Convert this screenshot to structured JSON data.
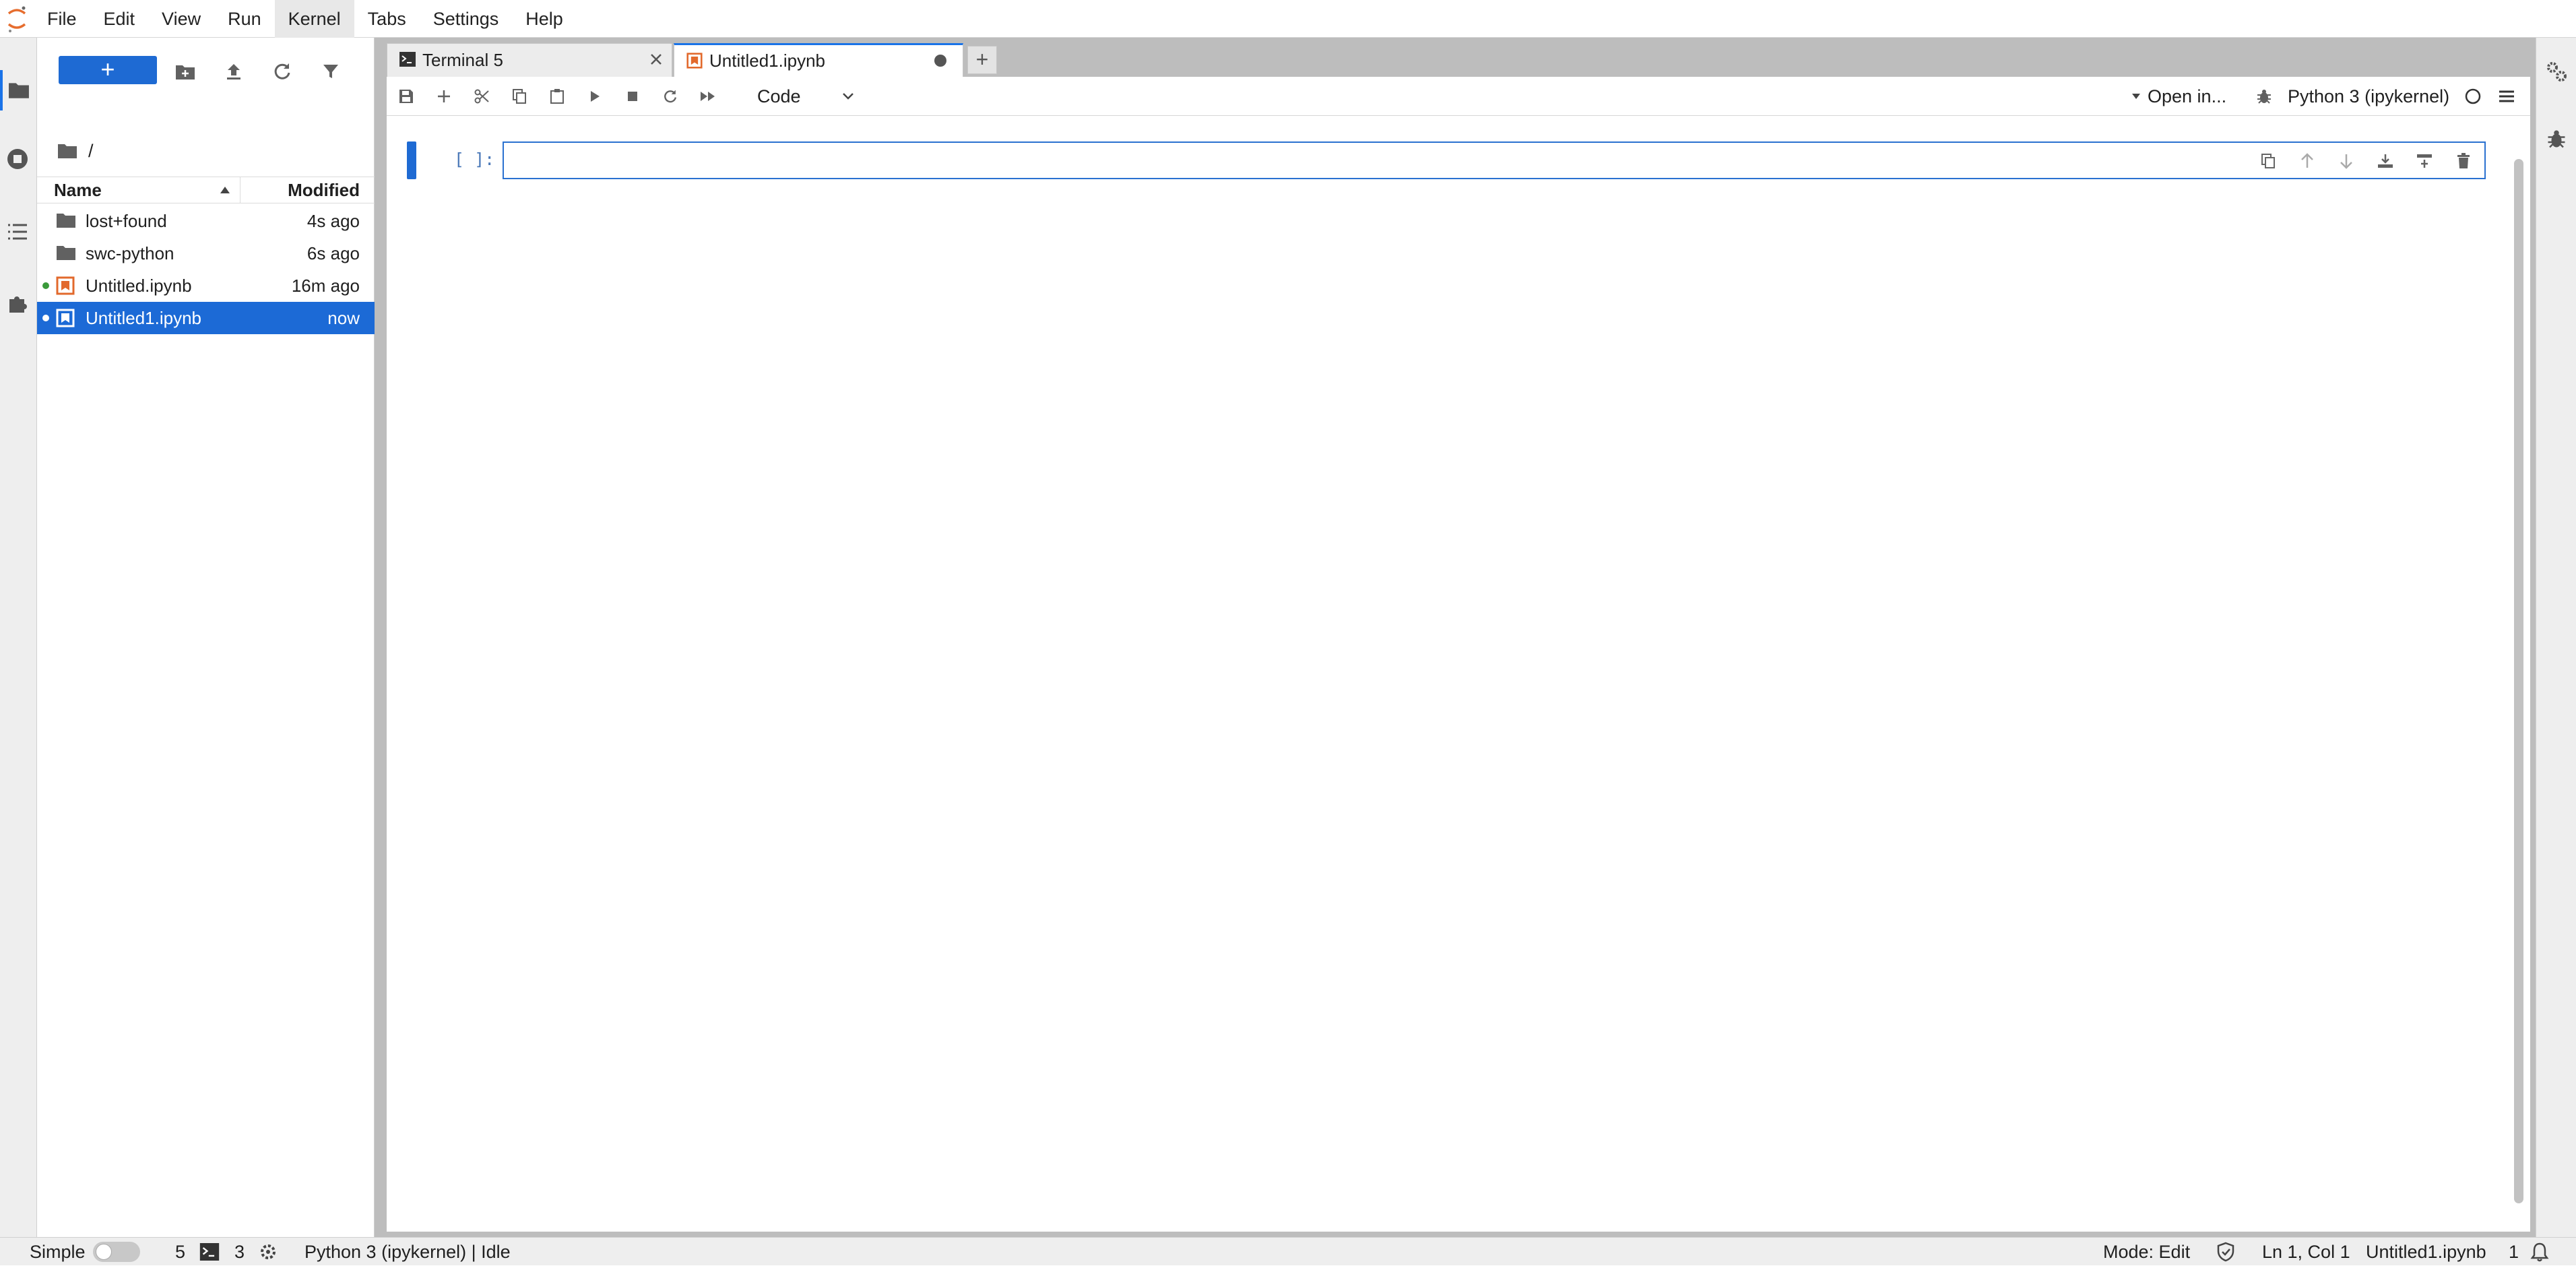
{
  "menubar": {
    "items": [
      "File",
      "Edit",
      "View",
      "Run",
      "Kernel",
      "Tabs",
      "Settings",
      "Help"
    ],
    "active": "Kernel"
  },
  "filebrowser": {
    "new_label": "+",
    "path": "/",
    "columns": {
      "name": "Name",
      "modified": "Modified"
    },
    "files": [
      {
        "name": "lost+found",
        "modified": "4s ago",
        "type": "folder",
        "running": false
      },
      {
        "name": "swc-python",
        "modified": "6s ago",
        "type": "folder",
        "running": false
      },
      {
        "name": "Untitled.ipynb",
        "modified": "16m ago",
        "type": "notebook",
        "running": true
      },
      {
        "name": "Untitled1.ipynb",
        "modified": "now",
        "type": "notebook",
        "running": true,
        "selected": true
      }
    ]
  },
  "tabs": [
    {
      "label": "Terminal 5",
      "icon": "terminal-icon",
      "active": false
    },
    {
      "label": "Untitled1.ipynb",
      "icon": "notebook-icon",
      "active": true,
      "dirty": true
    }
  ],
  "notebook": {
    "cell_type": "Code",
    "open_in": "Open in...",
    "kernel": "Python 3 (ipykernel)",
    "cell": {
      "prompt": "[ ]:",
      "source": ""
    }
  },
  "statusbar": {
    "mode_label": "Simple",
    "terminals_count": "5",
    "kernels_count": "3",
    "kernel_status": "Python 3 (ipykernel) | Idle",
    "mode": "Mode: Edit",
    "cursor": "Ln 1, Col 1",
    "file": "Untitled1.ipynb",
    "notifications": "1"
  },
  "colors": {
    "accent": "#1e6ad3",
    "selection": "#1c6ad6",
    "running_dot_green": "#3a9a3a",
    "notebook_icon_orange": "#e2692c"
  }
}
